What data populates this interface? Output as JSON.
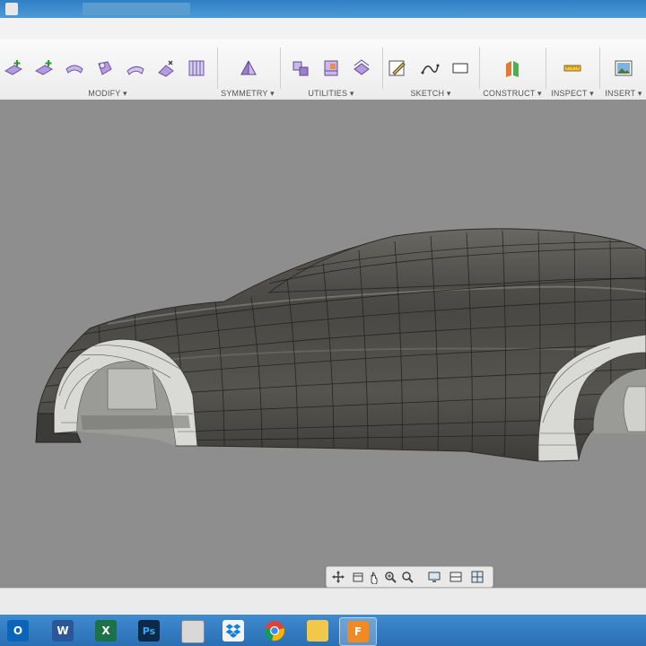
{
  "toolbar": {
    "groups": {
      "modify": "MODIFY ▾",
      "symmetry": "SYMMETRY ▾",
      "utilities": "UTILITIES ▾",
      "sketch": "SKETCH ▾",
      "construct": "CONSTRUCT ▾",
      "inspect": "INSPECT ▾",
      "insert": "INSERT ▾"
    }
  },
  "icons": {
    "modify": [
      "insert-edge-icon",
      "insert-point-icon",
      "merge-edge-icon",
      "bevel-edge-icon",
      "slide-edge-icon",
      "pull-icon",
      "flatten-icon"
    ],
    "symmetry": [
      "mirror-internal-icon"
    ],
    "utilities": [
      "convert-icon",
      "repair-body-icon",
      "make-uniform-icon"
    ],
    "sketch": [
      "edit-sketch-icon",
      "spline-icon",
      "rectangle-icon"
    ],
    "construct": [
      "plane-icon"
    ],
    "inspect": [
      "measure-icon"
    ],
    "insert": [
      "insert-image-icon"
    ]
  },
  "taskbar": {
    "apps": [
      "outlook-icon",
      "word-icon",
      "excel-icon",
      "photoshop-icon",
      "document-icon",
      "dropbox-icon",
      "chrome-icon",
      "file-explorer-icon",
      "fusion360-icon"
    ],
    "glyphs": {
      "outlook": "O",
      "word": "W",
      "excel": "X",
      "photoshop": "Ps",
      "fusion": "F"
    }
  },
  "colors": {
    "viewport_bg": "#8e8e8e",
    "model_surface": "#4b4a47",
    "toolbar_icon_purple": "#9a7fc9",
    "taskbar_blue": "#2f7bc2"
  }
}
